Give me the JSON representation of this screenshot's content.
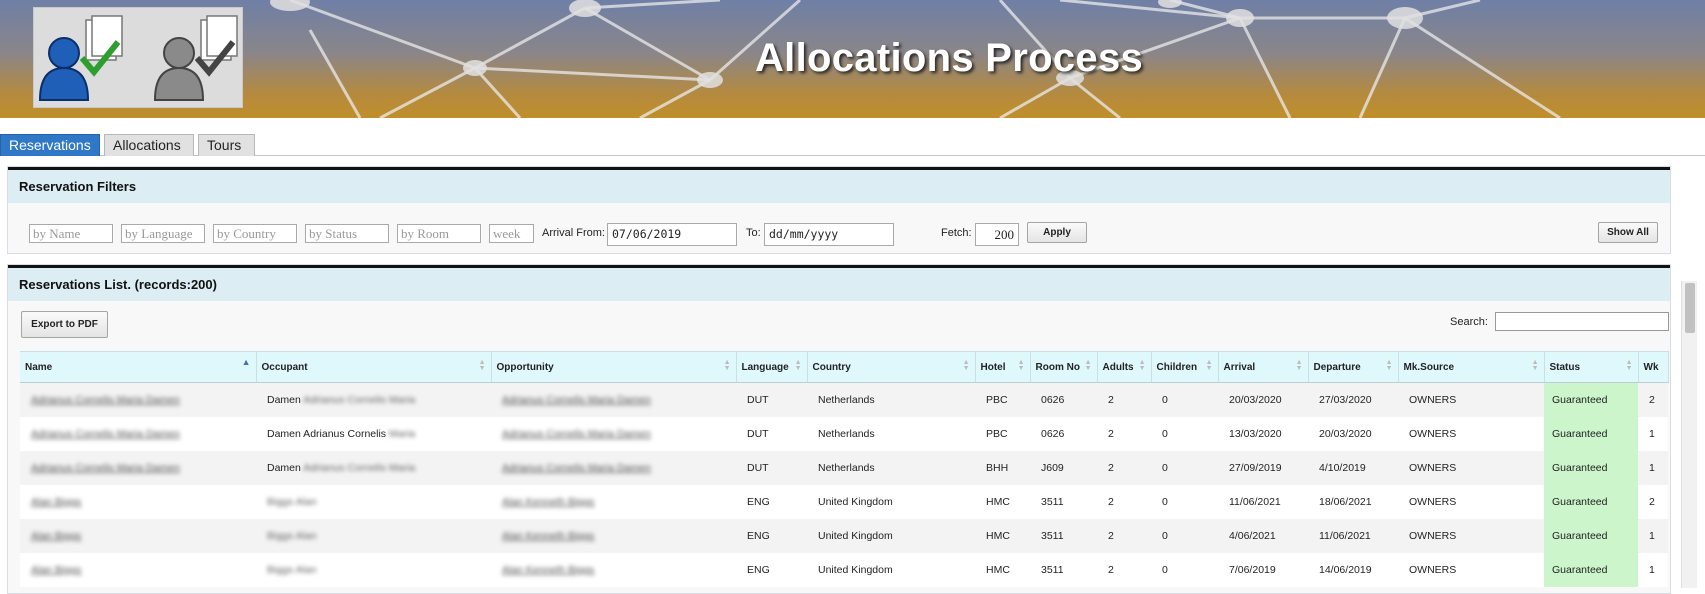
{
  "header": {
    "title": "Allocations Process"
  },
  "tabs": [
    {
      "label": "Reservations"
    },
    {
      "label": "Allocations"
    },
    {
      "label": "Tours"
    }
  ],
  "filters": {
    "title": "Reservation Filters",
    "name_placeholder": "by Name",
    "language_placeholder": "by Language",
    "country_placeholder": "by Country",
    "status_placeholder": "by Status",
    "room_placeholder": "by Room",
    "week_placeholder": "week",
    "arrival_from_label": "Arrival From:",
    "arrival_from_value": "07/06/2019",
    "to_label": "To:",
    "to_value": "dd/mm/yyyy",
    "fetch_label": "Fetch:",
    "fetch_value": "200",
    "apply_label": "Apply",
    "show_all_label": "Show All"
  },
  "list": {
    "title": "Reservations List. (records:200)",
    "export_label": "Export to PDF",
    "search_label": "Search:",
    "columns": [
      "Name",
      "Occupant",
      "Opportunity",
      "Language",
      "Country",
      "Hotel",
      "Room No",
      "Adults",
      "Children",
      "Arrival",
      "Departure",
      "Mk.Source",
      "Status",
      "Wk"
    ],
    "rows": [
      {
        "name": "Adrianus Cornelis Maria Damen",
        "occupant_first": "Damen",
        "occupant_rest": "Adrianus Cornelis Maria",
        "opportunity": "Adrianus Cornelis Maria Damen",
        "language": "DUT",
        "country": "Netherlands",
        "hotel": "PBC",
        "room": "0626",
        "adults": "2",
        "children": "0",
        "arrival": "20/03/2020",
        "departure": "27/03/2020",
        "source": "OWNERS",
        "status": "Guaranteed",
        "wk": "2"
      },
      {
        "name": "Adrianus Cornelis Maria Damen",
        "occupant_first": "Damen Adrianus Cornelis",
        "occupant_rest": "Maria",
        "opportunity": "Adrianus Cornelis Maria Damen",
        "language": "DUT",
        "country": "Netherlands",
        "hotel": "PBC",
        "room": "0626",
        "adults": "2",
        "children": "0",
        "arrival": "13/03/2020",
        "departure": "20/03/2020",
        "source": "OWNERS",
        "status": "Guaranteed",
        "wk": "1"
      },
      {
        "name": "Adrianus Cornelis Maria Damen",
        "occupant_first": "Damen",
        "occupant_rest": "Adrianus Cornelis Maria",
        "opportunity": "Adrianus Cornelis Maria Damen",
        "language": "DUT",
        "country": "Netherlands",
        "hotel": "BHH",
        "room": "J609",
        "adults": "2",
        "children": "0",
        "arrival": "27/09/2019",
        "departure": "4/10/2019",
        "source": "OWNERS",
        "status": "Guaranteed",
        "wk": "1"
      },
      {
        "name": "Alan Biggs",
        "occupant_first": "",
        "occupant_rest": "Biggs Alan",
        "opportunity": "Alan Kenneth Biggs",
        "language": "ENG",
        "country": "United Kingdom",
        "hotel": "HMC",
        "room": "3511",
        "adults": "2",
        "children": "0",
        "arrival": "11/06/2021",
        "departure": "18/06/2021",
        "source": "OWNERS",
        "status": "Guaranteed",
        "wk": "2"
      },
      {
        "name": "Alan Biggs",
        "occupant_first": "",
        "occupant_rest": "Biggs Alan",
        "opportunity": "Alan Kenneth Biggs",
        "language": "ENG",
        "country": "United Kingdom",
        "hotel": "HMC",
        "room": "3511",
        "adults": "2",
        "children": "0",
        "arrival": "4/06/2021",
        "departure": "11/06/2021",
        "source": "OWNERS",
        "status": "Guaranteed",
        "wk": "1"
      },
      {
        "name": "Alan Biggs",
        "occupant_first": "",
        "occupant_rest": "Biggs Alan",
        "opportunity": "Alan Kenneth Biggs",
        "language": "ENG",
        "country": "United Kingdom",
        "hotel": "HMC",
        "room": "3511",
        "adults": "2",
        "children": "0",
        "arrival": "7/06/2019",
        "departure": "14/06/2019",
        "source": "OWNERS",
        "status": "Guaranteed",
        "wk": "1"
      }
    ]
  },
  "colors": {
    "tab_active": "#2f78c8",
    "panel_header": "#dcedf3",
    "table_header": "#dff8fb",
    "status_bg": "#ccf5cc"
  }
}
